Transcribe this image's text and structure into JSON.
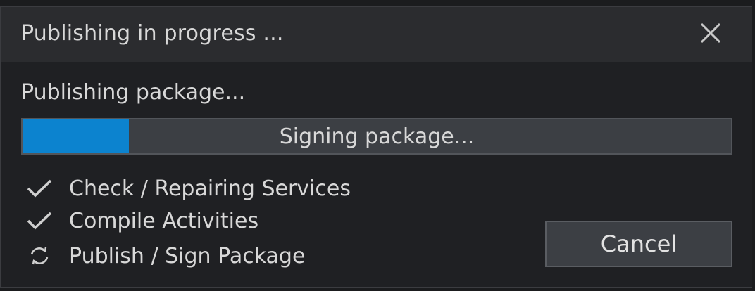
{
  "dialog": {
    "title": "Publishing in progress ...",
    "status_text": "Publishing package...",
    "progress": {
      "fraction": 0.15,
      "label": "Signing package...",
      "fill_color": "#0c83cf"
    },
    "steps": [
      {
        "label": "Check / Repairing Services",
        "icon": "check-icon",
        "state": "done"
      },
      {
        "label": "Compile Activities",
        "icon": "check-icon",
        "state": "done"
      },
      {
        "label": "Publish / Sign Package",
        "icon": "refresh-icon",
        "state": "in-progress"
      }
    ],
    "cancel_label": "Cancel"
  }
}
